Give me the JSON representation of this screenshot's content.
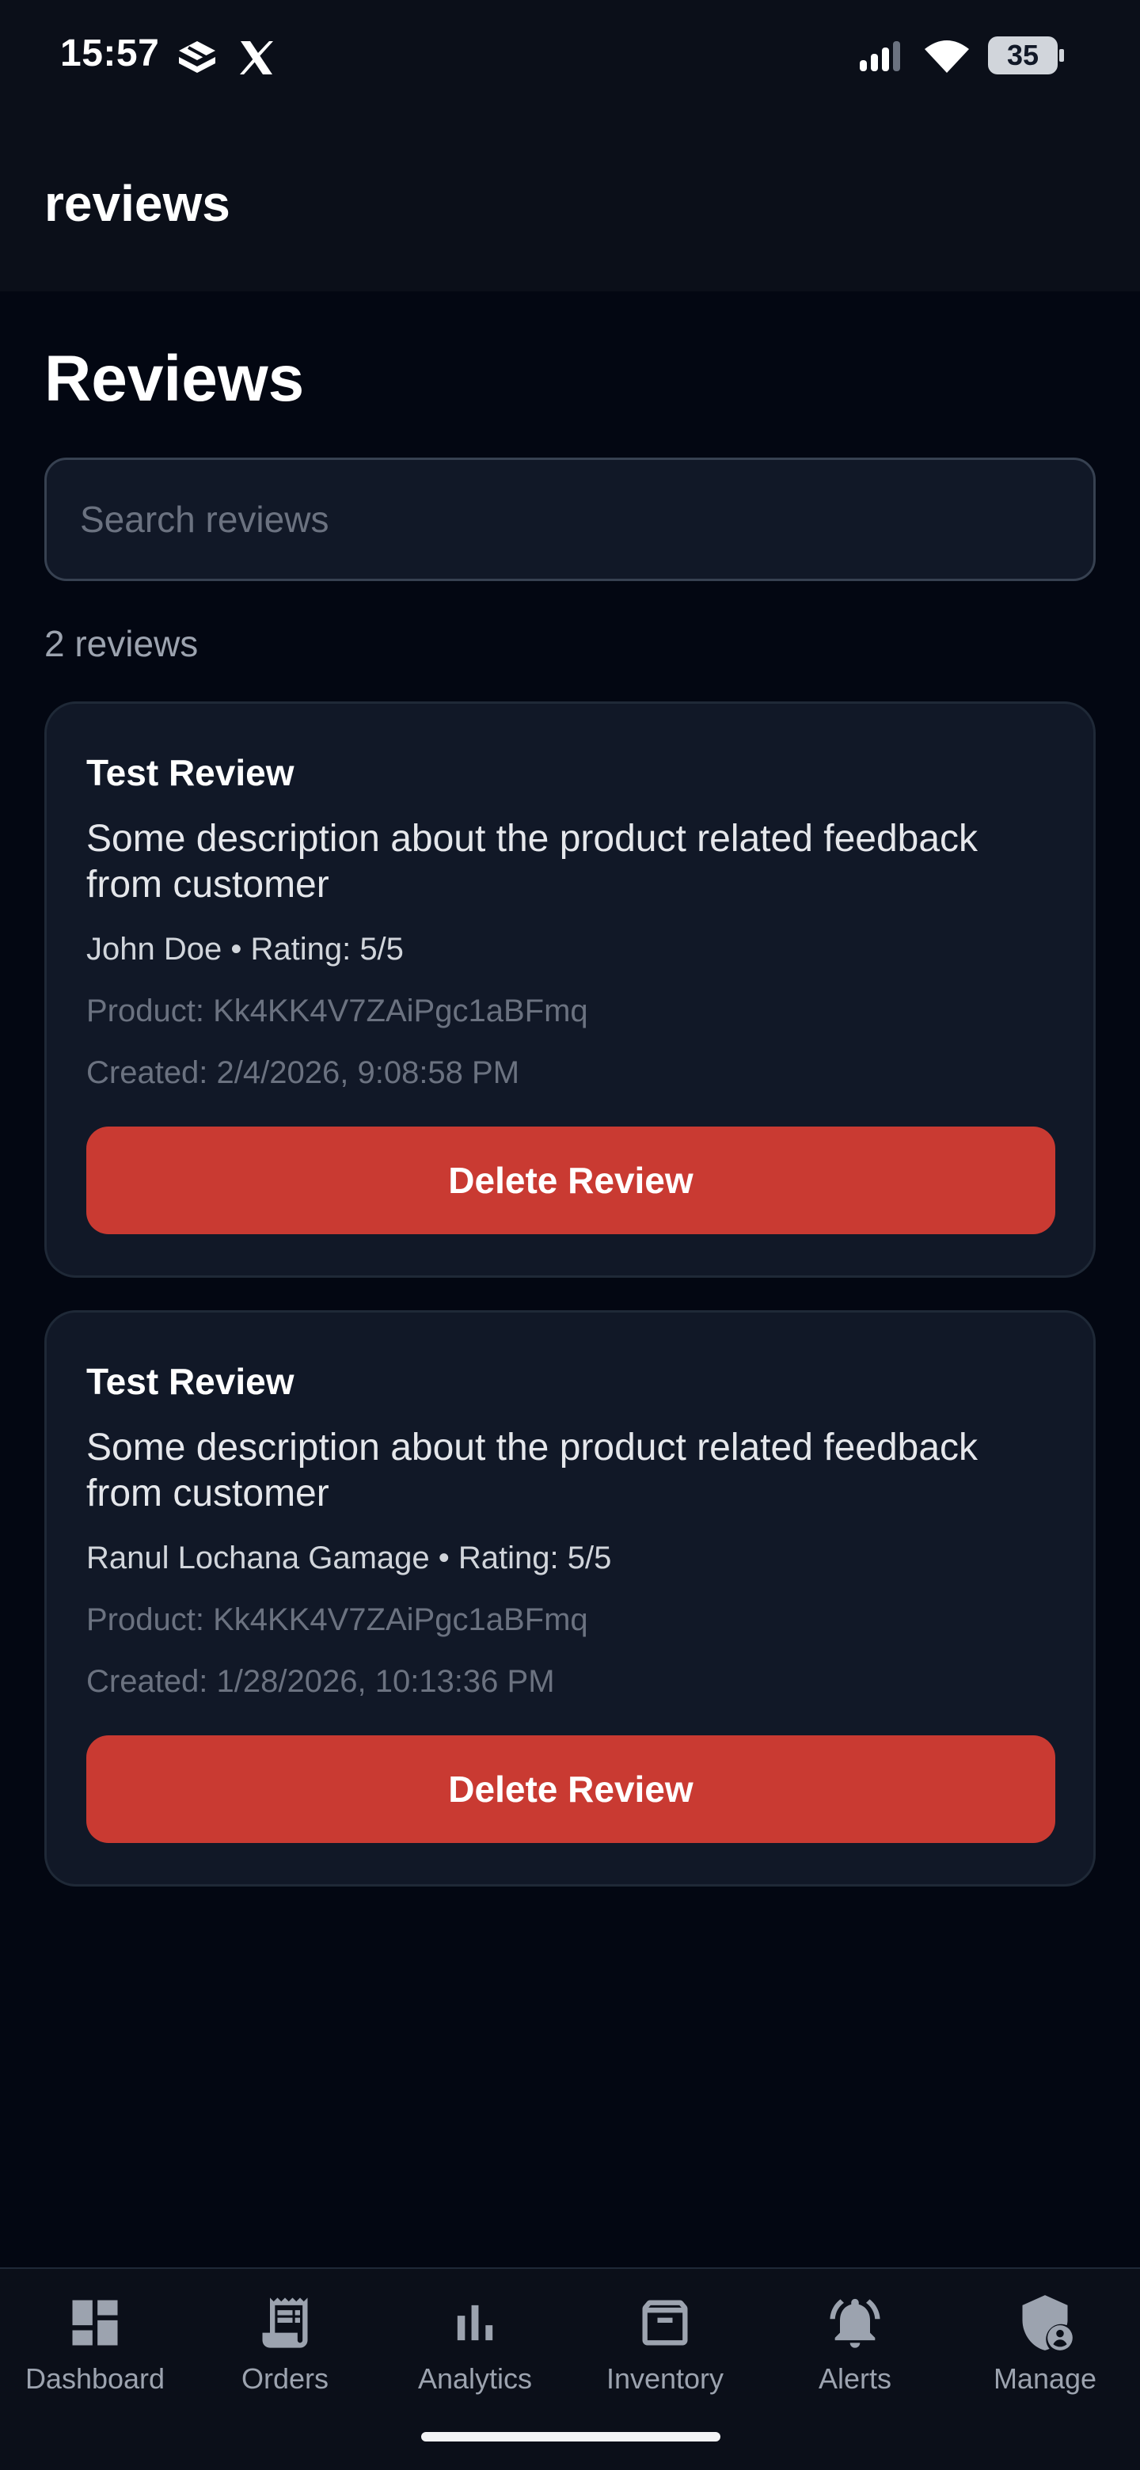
{
  "status_bar": {
    "time": "15:57",
    "battery": "35",
    "icons": [
      "app-notification-icon",
      "x-icon",
      "signal-icon",
      "wifi-icon",
      "battery-icon"
    ]
  },
  "app_bar": {
    "title": "reviews"
  },
  "page": {
    "heading": "Reviews",
    "search_placeholder": "Search reviews",
    "search_value": "",
    "count_text": "2 reviews"
  },
  "reviews": [
    {
      "title": "Test Review",
      "description": "Some description about the product related feedback from customer",
      "author_rating": "John Doe • Rating: 5/5",
      "product": "Product: Kk4KK4V7ZAiPgc1aBFmq",
      "created": "Created: 2/4/2026, 9:08:58 PM",
      "delete_label": "Delete Review"
    },
    {
      "title": "Test Review",
      "description": "Some description about the product related feedback from customer",
      "author_rating": "Ranul Lochana Gamage • Rating: 5/5",
      "product": "Product: Kk4KK4V7ZAiPgc1aBFmq",
      "created": "Created: 1/28/2026, 10:13:36 PM",
      "delete_label": "Delete Review"
    }
  ],
  "bottom_nav": {
    "items": [
      {
        "label": "Dashboard",
        "icon": "dashboard-icon"
      },
      {
        "label": "Orders",
        "icon": "receipt-icon"
      },
      {
        "label": "Analytics",
        "icon": "bar-chart-icon"
      },
      {
        "label": "Inventory",
        "icon": "archive-box-icon"
      },
      {
        "label": "Alerts",
        "icon": "bell-icon"
      },
      {
        "label": "Manage",
        "icon": "shield-user-icon"
      }
    ]
  },
  "colors": {
    "background": "#030712",
    "surface": "#111827",
    "header": "#0b0f19",
    "danger": "#c93a32",
    "muted_text": "#9ca3af"
  }
}
